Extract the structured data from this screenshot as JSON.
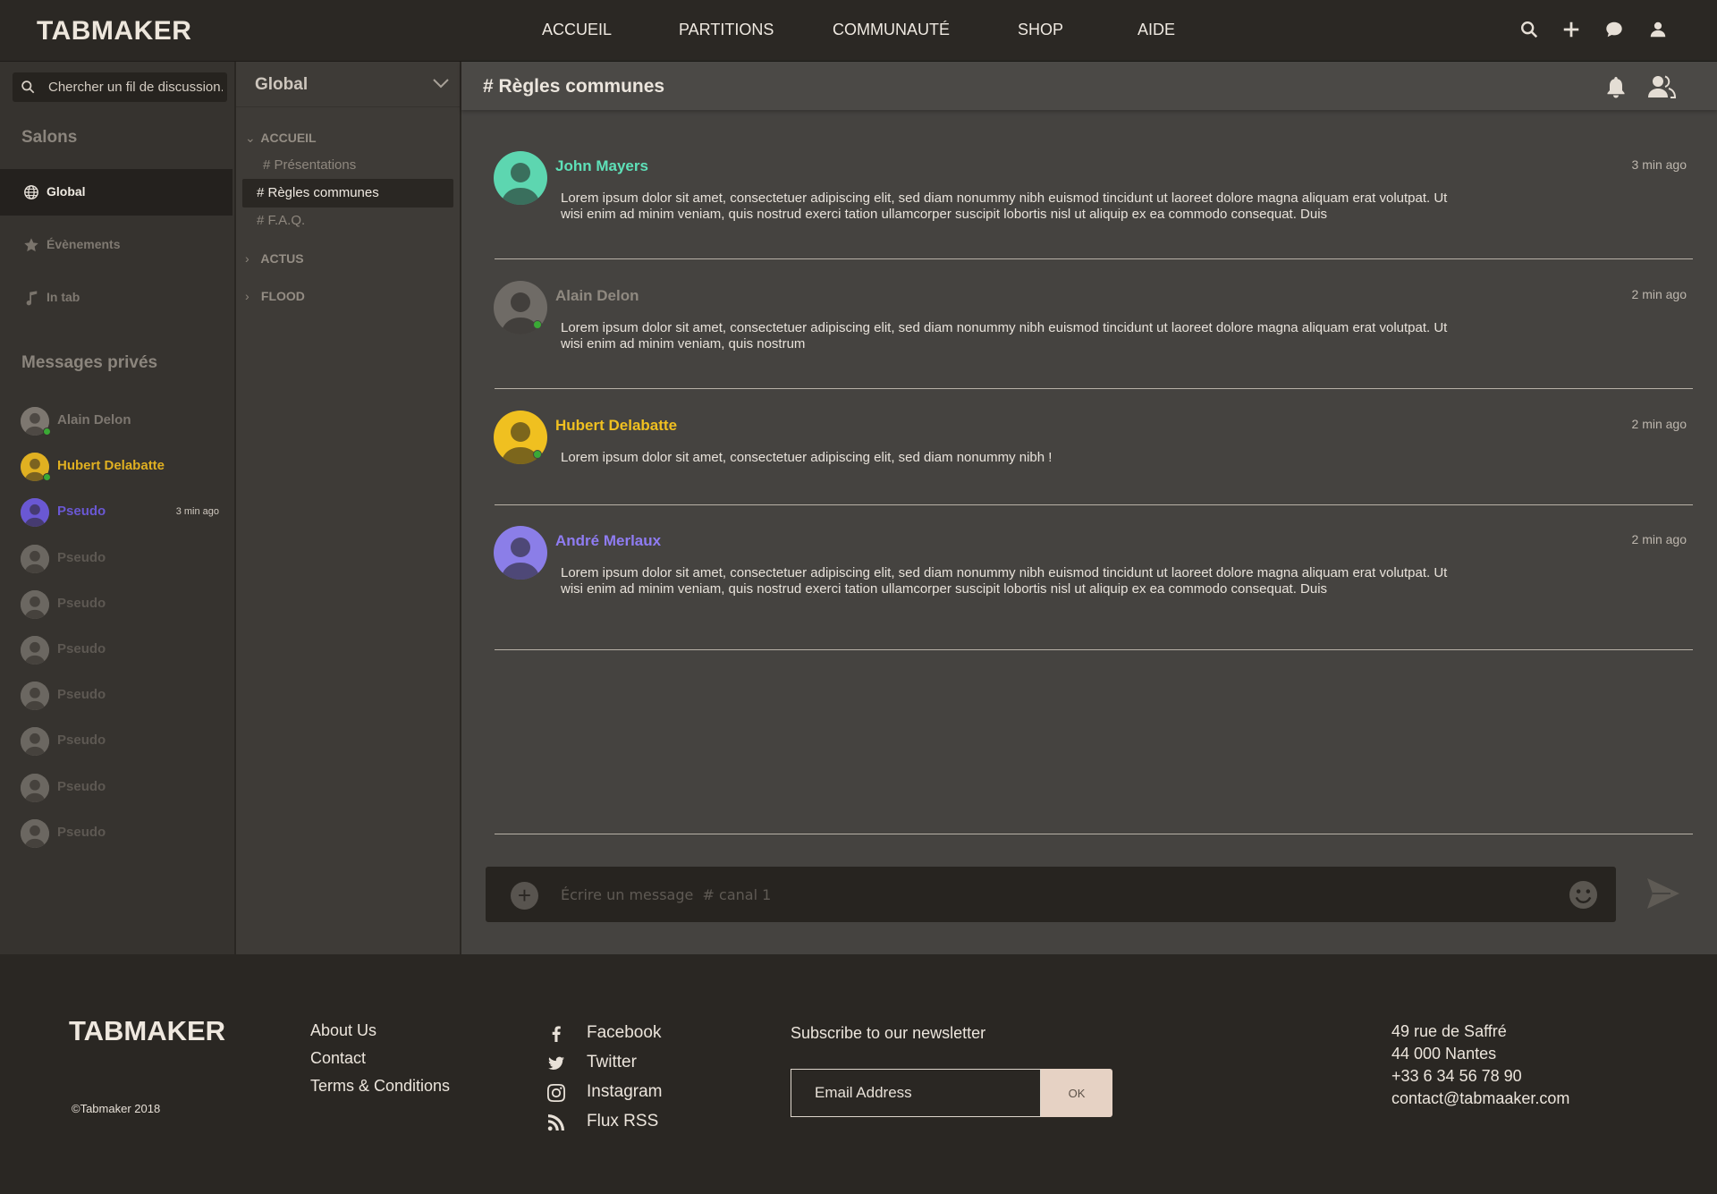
{
  "header": {
    "logo": "TABMAKER",
    "nav": [
      "ACCUEIL",
      "PARTITIONS",
      "COMMUNAUTÉ",
      "SHOP",
      "AIDE"
    ],
    "icons": [
      "search-icon",
      "plus-icon",
      "chat-icon",
      "user-icon"
    ]
  },
  "sidebar": {
    "search_placeholder": "Chercher un fil de discussion...",
    "rooms_title": "Salons",
    "rooms": [
      {
        "label": "Global",
        "icon": "globe-icon",
        "active": true
      },
      {
        "label": "Évènements",
        "icon": "star-icon",
        "active": false
      },
      {
        "label": "In tab",
        "icon": "music-note-icon",
        "active": false
      }
    ],
    "dm_title": "Messages privés",
    "dms": [
      {
        "name": "Alain Delon",
        "online": true,
        "color": "#7d7770",
        "time": ""
      },
      {
        "name": "Hubert Delabatte",
        "online": true,
        "color": "#e0b021",
        "time": ""
      },
      {
        "name": "Pseudo",
        "online": false,
        "color": "#6a58d3",
        "time": "3 min ago"
      },
      {
        "name": "Pseudo",
        "online": false,
        "color": "#5d5852",
        "time": ""
      },
      {
        "name": "Pseudo",
        "online": false,
        "color": "#5d5852",
        "time": ""
      },
      {
        "name": "Pseudo",
        "online": false,
        "color": "#5d5852",
        "time": ""
      },
      {
        "name": "Pseudo",
        "online": false,
        "color": "#5d5852",
        "time": ""
      },
      {
        "name": "Pseudo",
        "online": false,
        "color": "#5d5852",
        "time": ""
      },
      {
        "name": "Pseudo",
        "online": false,
        "color": "#5d5852",
        "time": ""
      },
      {
        "name": "Pseudo",
        "online": false,
        "color": "#5d5852",
        "time": ""
      }
    ]
  },
  "channels": {
    "server": "Global",
    "categories": [
      {
        "name": "ACCUEIL",
        "expanded": true,
        "channels": [
          "# Présentations",
          "# Règles communes",
          "# F.A.Q."
        ],
        "active": "# Règles communes"
      },
      {
        "name": "ACTUS",
        "expanded": false
      },
      {
        "name": "FLOOD",
        "expanded": false
      }
    ]
  },
  "main": {
    "title": "# Règles communes",
    "messages": [
      {
        "name": "John Mayers",
        "color": "#5ee0b8",
        "avatar_bg": "#5dd6b0",
        "time": "3 min ago",
        "online": false,
        "text": "Lorem ipsum dolor sit amet, consectetuer adipiscing elit, sed diam nonummy nibh euismod tincidunt ut laoreet dolore magna aliquam erat volutpat. Ut wisi enim ad minim veniam, quis nostrud exerci tation ullamcorper suscipit lobortis nisl ut aliquip ex ea commodo consequat. Duis"
      },
      {
        "name": "Alain Delon",
        "color": "#8f8980",
        "avatar_bg": "#6f6b66",
        "time": "2 min ago",
        "online": true,
        "text": "Lorem ipsum dolor sit amet, consectetuer adipiscing elit, sed diam nonummy nibh euismod tincidunt ut laoreet dolore magna aliquam erat volutpat. Ut wisi enim ad minim veniam, quis nostrum"
      },
      {
        "name": "Hubert Delabatte",
        "color": "#f0c020",
        "avatar_bg": "#f0c020",
        "time": "2 min ago",
        "online": true,
        "text": "Lorem ipsum dolor sit amet, consectetuer adipiscing elit, sed diam nonummy nibh !"
      },
      {
        "name": "André Merlaux",
        "color": "#8f7cf2",
        "avatar_bg": "#8b7ee8",
        "time": "2 min ago",
        "online": false,
        "text": "Lorem ipsum dolor sit amet, consectetuer adipiscing elit, sed diam nonummy nibh euismod tincidunt ut laoreet dolore magna aliquam erat volutpat. Ut wisi enim ad minim veniam, quis nostrud exerci tation ullamcorper suscipit lobortis nisl ut aliquip ex ea commodo consequat. Duis"
      }
    ],
    "composer_placeholder": "Écrire un message  # canal 1"
  },
  "footer": {
    "logo": "TABMAKER",
    "copyright": "©Tabmaker  2018",
    "links": [
      "About Us",
      "Contact",
      "Terms & Conditions"
    ],
    "social": [
      {
        "label": "Facebook",
        "icon": "facebook-icon"
      },
      {
        "label": "Twitter",
        "icon": "twitter-icon"
      },
      {
        "label": "Instagram",
        "icon": "instagram-icon"
      },
      {
        "label": "Flux RSS",
        "icon": "rss-icon"
      }
    ],
    "newsletter_title": "Subscribe to our newsletter",
    "email_placeholder": "Email Address",
    "ok_label": "OK",
    "address": [
      "49 rue de Saffré",
      "44 000 Nantes",
      "+33 6 34 56 78 90",
      "contact@tabmaaker.com"
    ]
  }
}
